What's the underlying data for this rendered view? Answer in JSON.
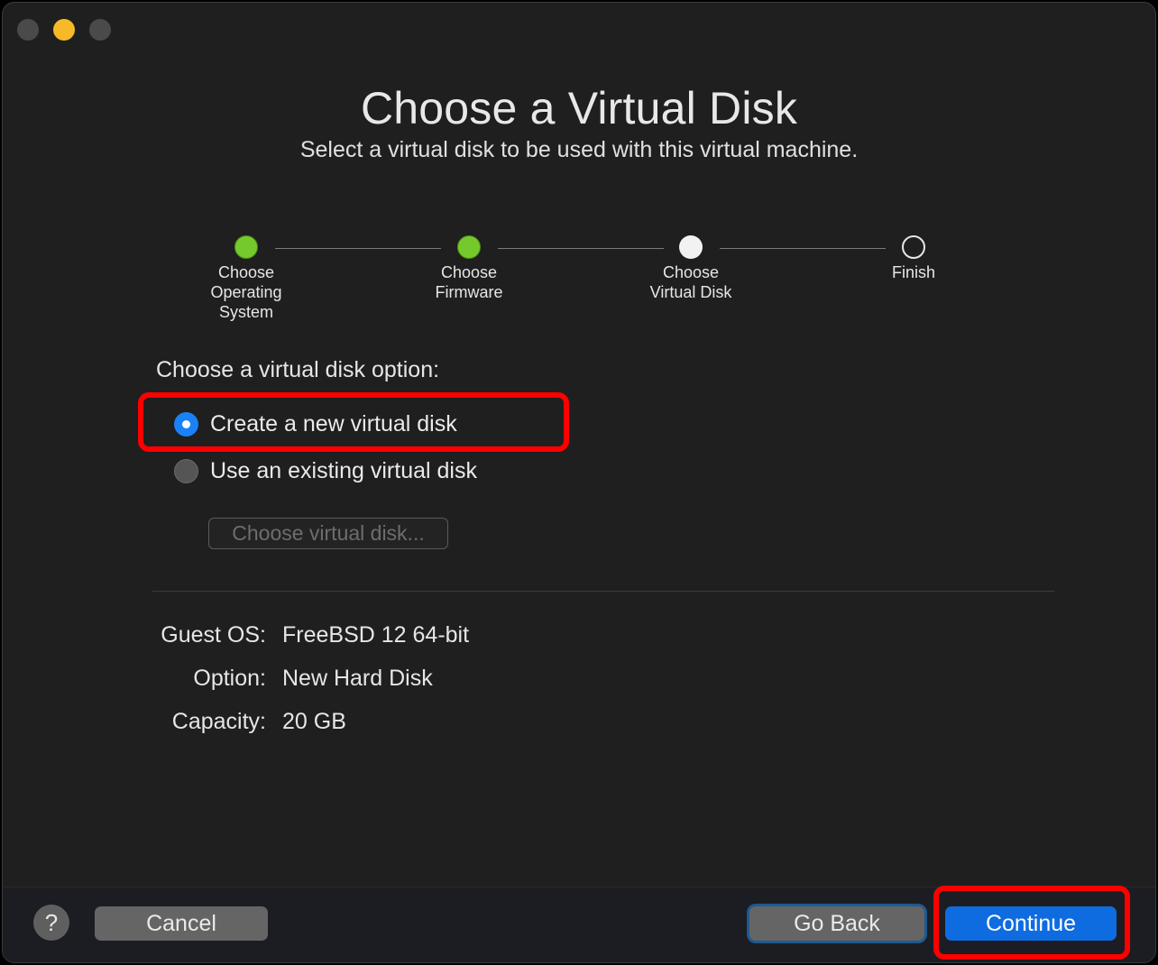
{
  "title": "Choose a Virtual Disk",
  "subtitle": "Select a virtual disk to be used with this virtual machine.",
  "steps": [
    {
      "label": "Choose\nOperating\nSystem",
      "state": "done"
    },
    {
      "label": "Choose\nFirmware",
      "state": "done"
    },
    {
      "label": "Choose\nVirtual Disk",
      "state": "current"
    },
    {
      "label": "Finish",
      "state": "todo"
    }
  ],
  "disk_option": {
    "label": "Choose a virtual disk option:",
    "options": [
      {
        "label": "Create a new virtual disk",
        "selected": true
      },
      {
        "label": "Use an existing virtual disk",
        "selected": false
      }
    ],
    "choose_button": "Choose virtual disk..."
  },
  "summary": {
    "guest_os_key": "Guest OS:",
    "guest_os_value": "FreeBSD 12 64-bit",
    "option_key": "Option:",
    "option_value": "New Hard Disk",
    "capacity_key": "Capacity:",
    "capacity_value": "20 GB"
  },
  "footer": {
    "help": "?",
    "cancel": "Cancel",
    "go_back": "Go Back",
    "continue": "Continue"
  },
  "colors": {
    "accent": "#1a82f7",
    "done_step": "#76c92b",
    "highlight": "#ff0000",
    "window_bg": "#1f1f1f"
  }
}
